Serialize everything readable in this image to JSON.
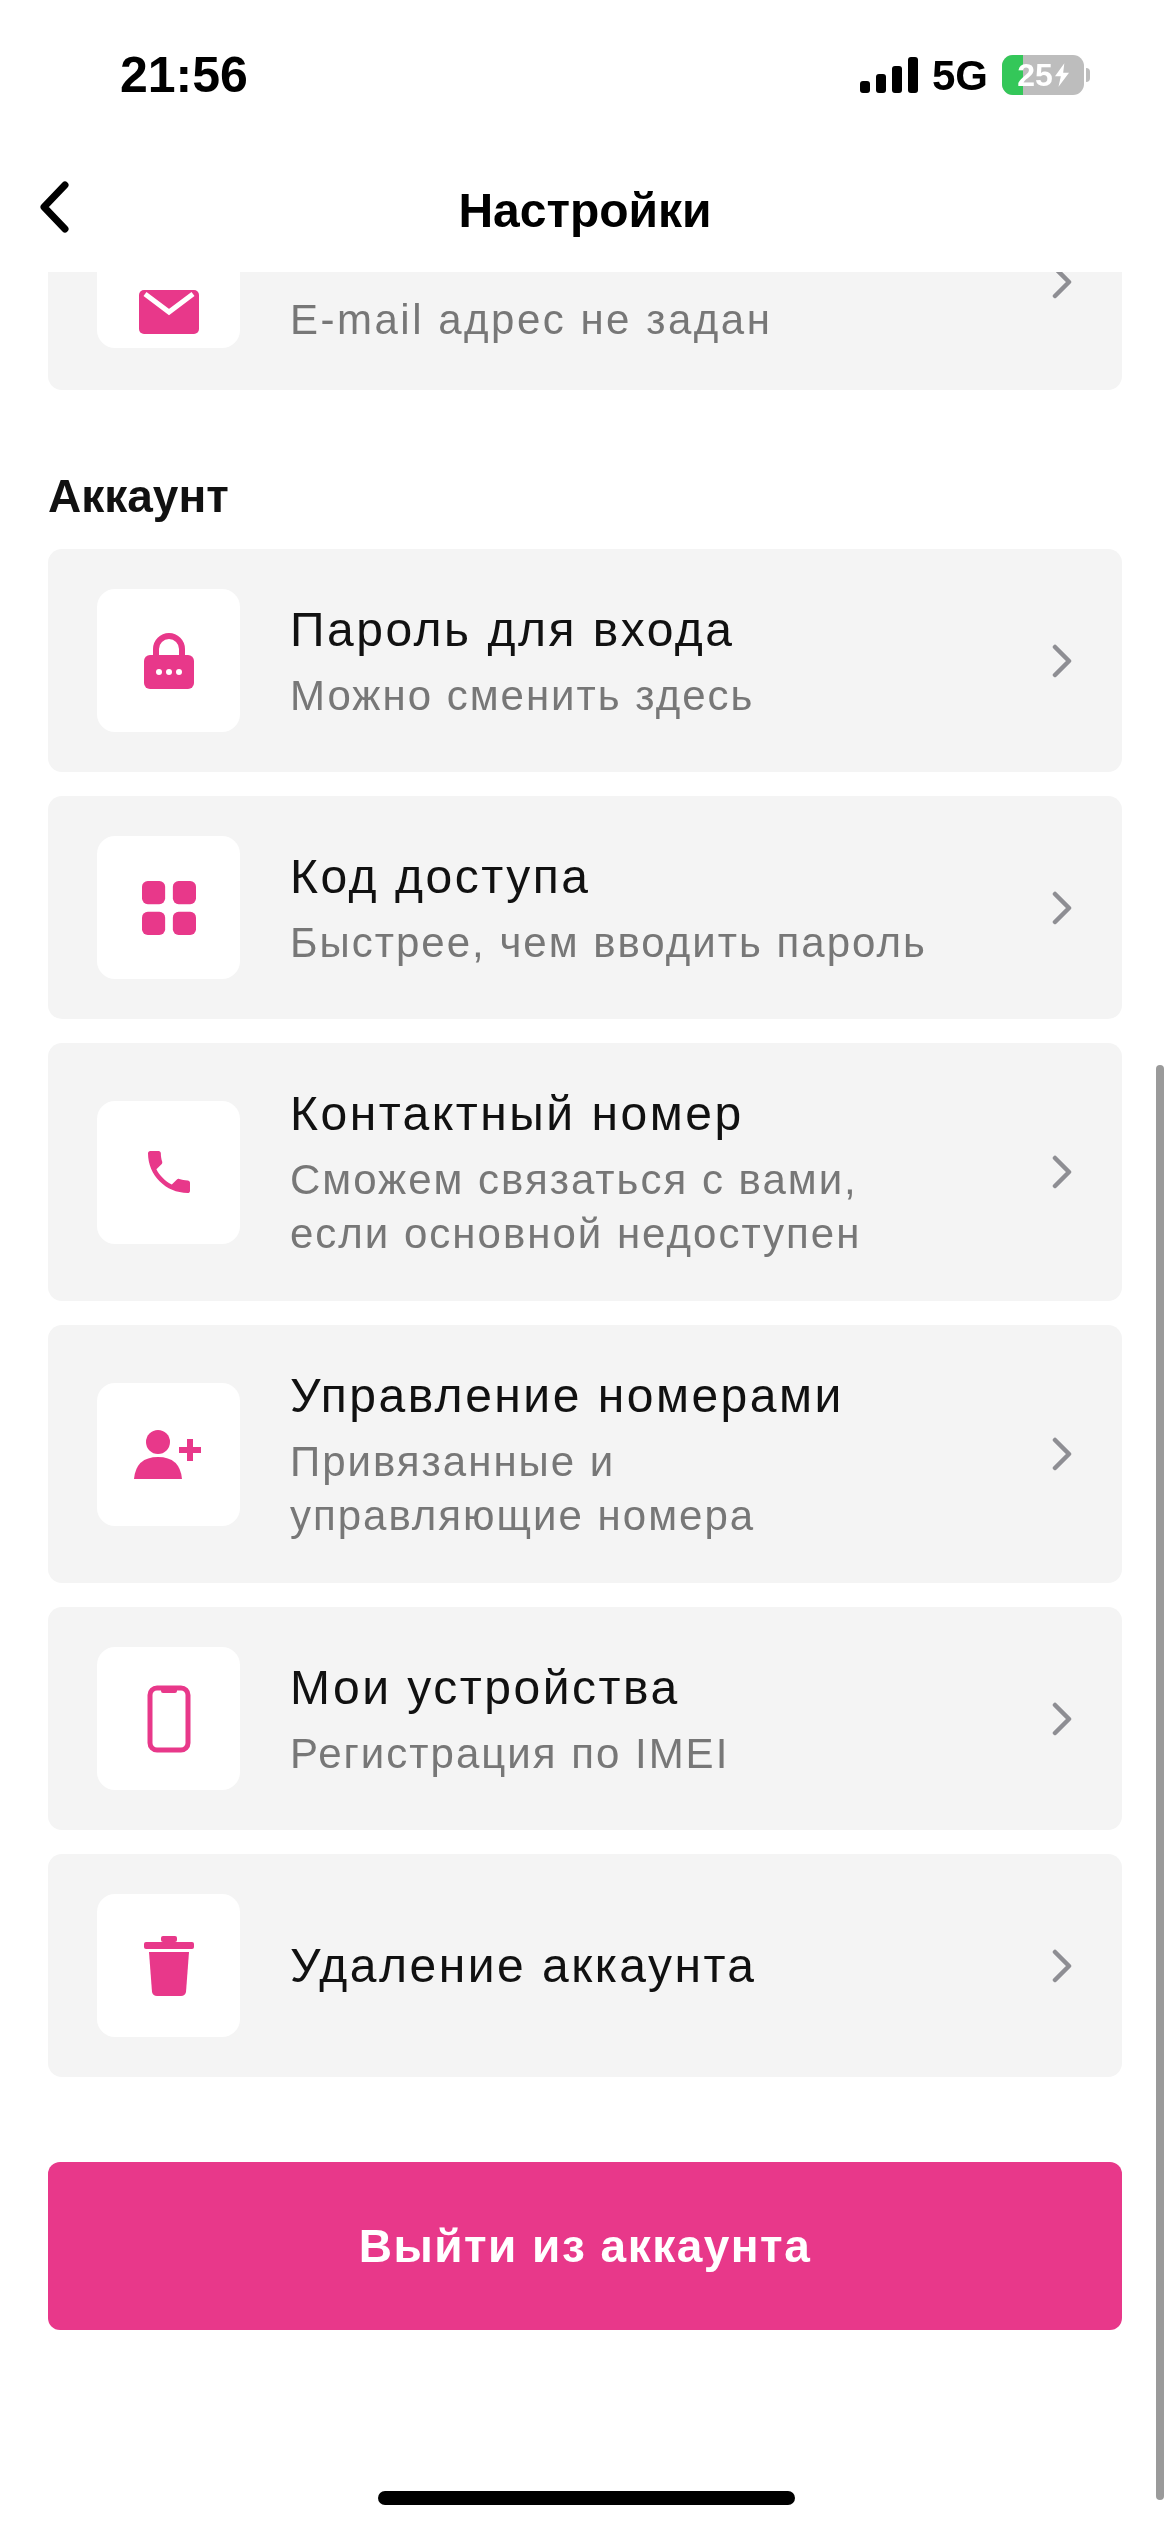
{
  "status_bar": {
    "time": "21:56",
    "network": "5G",
    "battery": "25"
  },
  "nav": {
    "title": "Настройки"
  },
  "partial_item": {
    "subtitle": "E-mail адрес не задан"
  },
  "section": {
    "title": "Аккаунт"
  },
  "items": [
    {
      "title": "Пароль для входа",
      "subtitle": "Можно сменить здесь"
    },
    {
      "title": "Код доступа",
      "subtitle": "Быстрее, чем вводить пароль"
    },
    {
      "title": "Контактный номер",
      "subtitle": "Сможем связаться с вами,\nесли основной недоступен"
    },
    {
      "title": "Управление номерами",
      "subtitle": "Привязанные и\nуправляющие номера"
    },
    {
      "title": "Мои устройства",
      "subtitle": "Регистрация по IMEI"
    },
    {
      "title": "Удаление аккаунта"
    }
  ],
  "logout_button": "Выйти из аккаунта"
}
